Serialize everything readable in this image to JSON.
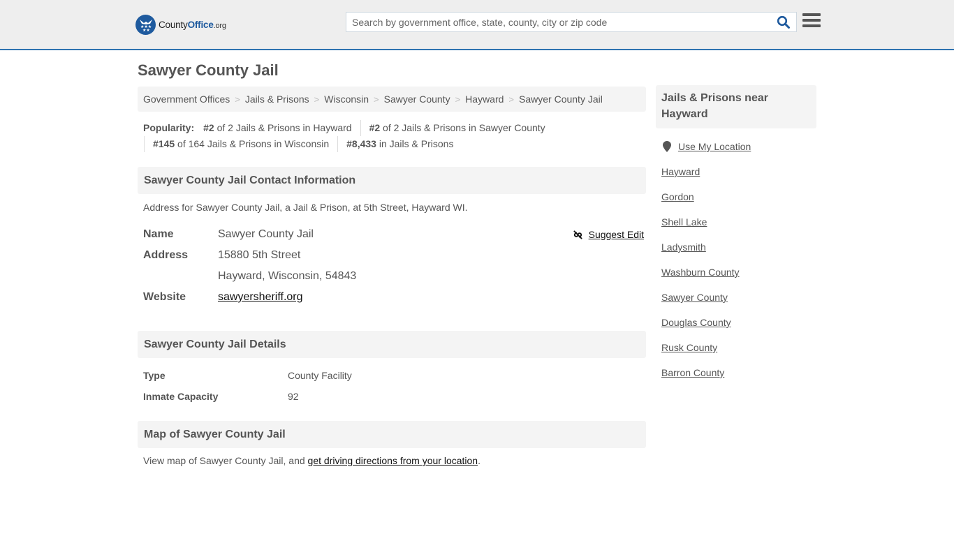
{
  "header": {
    "logo": {
      "county": "County",
      "office": "Office",
      "org": ".org",
      "icon": "eagle-stars-badge-icon"
    },
    "search": {
      "placeholder": "Search by government office, state, county, city or zip code",
      "value": "",
      "icon": "search-icon"
    },
    "menu_icon": "hamburger-menu-icon",
    "accent_color": "#2e73b0"
  },
  "page": {
    "title": "Sawyer County Jail"
  },
  "breadcrumb": [
    {
      "label": "Government Offices"
    },
    {
      "label": "Jails & Prisons"
    },
    {
      "label": "Wisconsin"
    },
    {
      "label": "Sawyer County"
    },
    {
      "label": "Hayward"
    },
    {
      "label": "Sawyer County Jail"
    }
  ],
  "popularity": {
    "label": "Popularity:",
    "items": [
      {
        "rank": "#2",
        "text": " of 2 Jails & Prisons in Hayward"
      },
      {
        "rank": "#2",
        "text": " of 2 Jails & Prisons in Sawyer County"
      },
      {
        "rank": "#145",
        "text": " of 164 Jails & Prisons in Wisconsin"
      },
      {
        "rank": "#8,433",
        "text": " in Jails & Prisons"
      }
    ]
  },
  "contact": {
    "heading": "Sawyer County Jail Contact Information",
    "note": "Address for Sawyer County Jail, a Jail & Prison, at 5th Street, Hayward WI.",
    "suggest_edit": "Suggest Edit",
    "rows": {
      "name_label": "Name",
      "name_value": "Sawyer County Jail",
      "address_label": "Address",
      "address_line1": "15880 5th Street",
      "address_line2": "Hayward, Wisconsin, 54843",
      "website_label": "Website",
      "website_value": "sawyersheriff.org"
    }
  },
  "details": {
    "heading": "Sawyer County Jail Details",
    "rows": [
      {
        "label": "Type",
        "value": "County Facility"
      },
      {
        "label": "Inmate Capacity",
        "value": "92"
      }
    ]
  },
  "map": {
    "heading": "Map of Sawyer County Jail",
    "note_prefix": "View map of Sawyer County Jail, and ",
    "directions_link": "get driving directions from your location",
    "note_suffix": "."
  },
  "sidebar": {
    "heading": "Jails & Prisons near Hayward",
    "use_location": "Use My Location",
    "links": [
      {
        "label": "Hayward"
      },
      {
        "label": "Gordon"
      },
      {
        "label": "Shell Lake"
      },
      {
        "label": "Ladysmith"
      },
      {
        "label": "Washburn County"
      },
      {
        "label": "Sawyer County"
      },
      {
        "label": "Douglas County"
      },
      {
        "label": "Rusk County"
      },
      {
        "label": "Barron County"
      }
    ]
  }
}
